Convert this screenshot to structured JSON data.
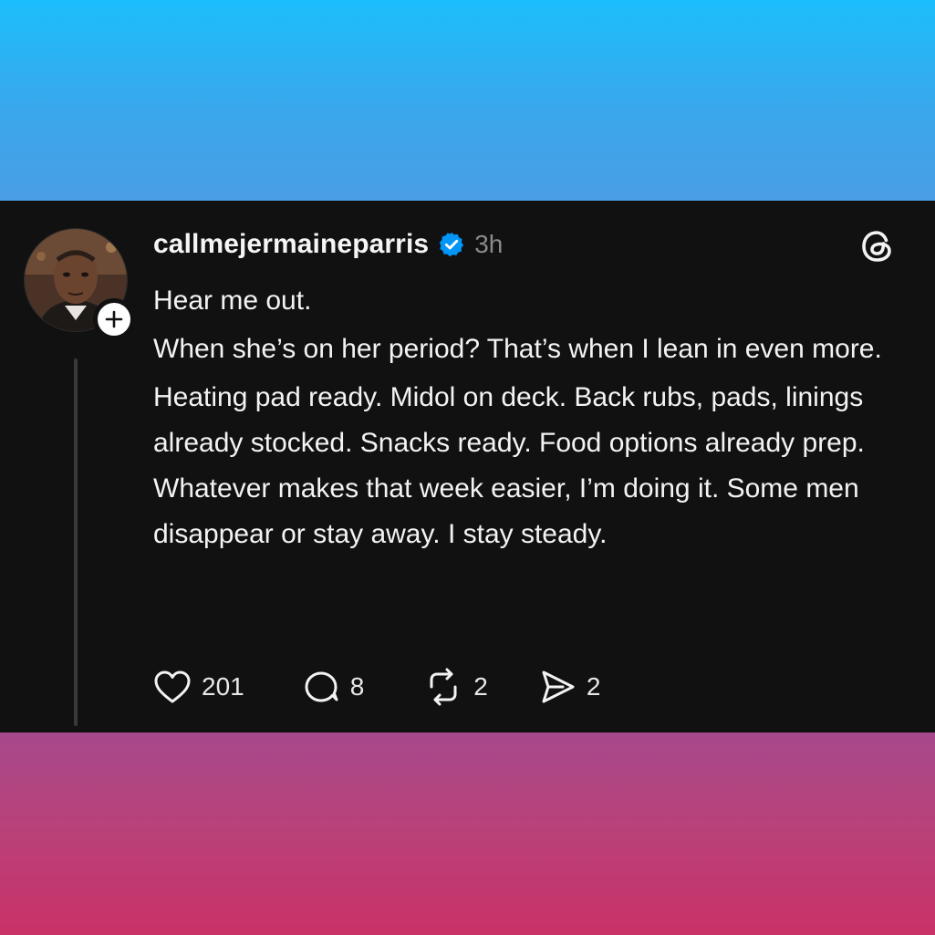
{
  "post": {
    "username": "callmejermaineparris",
    "time": "3h",
    "paragraphs": [
      "Hear me out.",
      "When she’s on her period? That’s when I lean in even more.",
      "Heating pad ready. Midol on deck. Back rubs, pads, linings already stocked. Snacks ready. Food options already prep. Whatever makes that week easier, I’m doing it. Some men disappear or stay away. I stay steady."
    ]
  },
  "actions": {
    "likes": "201",
    "replies": "8",
    "reposts": "2",
    "shares": "2"
  },
  "icons": {
    "verified": "verified-badge-icon",
    "follow": "plus-icon",
    "logo": "threads-logo-icon",
    "like": "heart-icon",
    "reply": "comment-icon",
    "repost": "repost-icon",
    "share": "send-icon"
  },
  "colors": {
    "top_gradient": "#1cbefc",
    "bottom_gradient": "#c83267",
    "card_background": "#111111",
    "verified_blue": "#0095f6",
    "muted_text": "#8a8a8a"
  }
}
